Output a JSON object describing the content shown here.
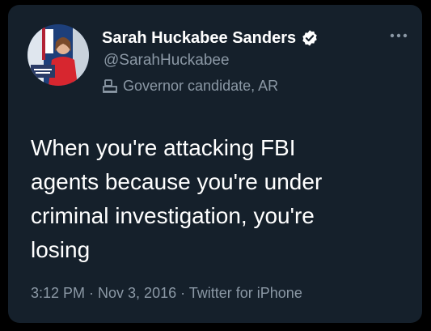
{
  "author": {
    "name": "Sarah Huckabee Sanders",
    "handle": "@SarahHuckabee",
    "verified_icon": "verified-badge-icon",
    "label": "Governor candidate, AR",
    "label_icon": "government-building-icon",
    "avatar": "profile-photo"
  },
  "menu": {
    "icon": "more-options-icon"
  },
  "tweet": {
    "lines": [
      "When you're attacking FBI",
      "agents because you're under",
      "criminal investigation, you're",
      "losing"
    ]
  },
  "meta": {
    "text": "3:12 PM · Nov 3, 2016 · Twitter for iPhone"
  },
  "colors": {
    "background": "#15202b",
    "primary_text": "#ffffff",
    "secondary_text": "#8b98a5",
    "verified_badge": "#ffffff"
  }
}
